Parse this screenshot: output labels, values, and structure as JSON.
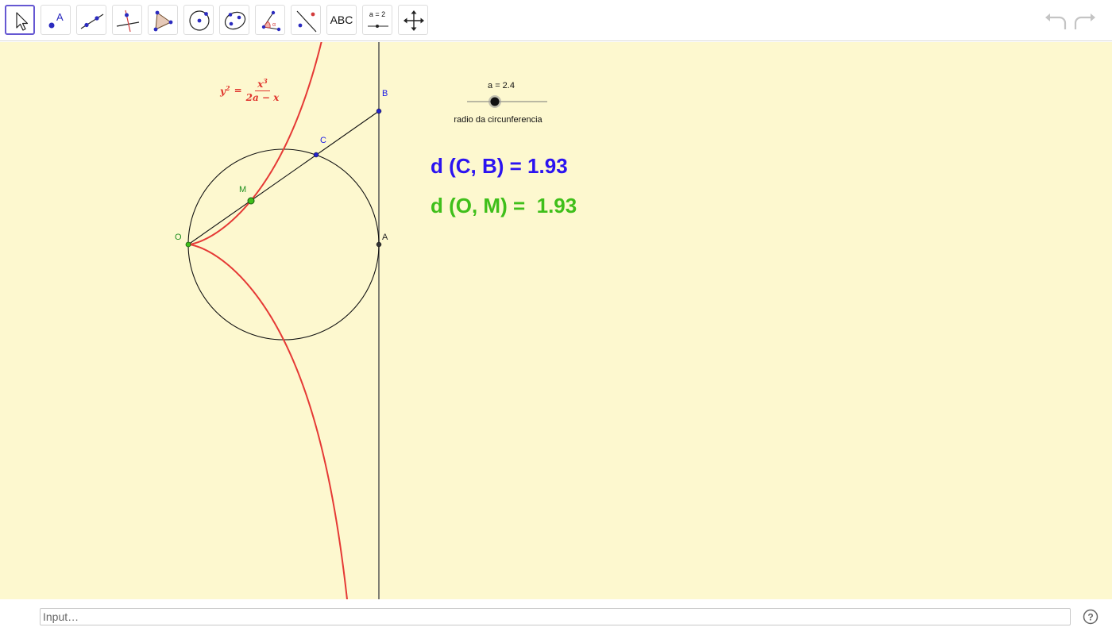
{
  "toolbar": {
    "tools": [
      {
        "id": "move",
        "icon": "arrow-pointer-icon"
      },
      {
        "id": "point",
        "icon": "point-icon",
        "text": "A"
      },
      {
        "id": "line",
        "icon": "line-through-points-icon"
      },
      {
        "id": "perpendicular",
        "icon": "perpendicular-line-icon"
      },
      {
        "id": "polygon",
        "icon": "polygon-icon"
      },
      {
        "id": "circle",
        "icon": "circle-center-point-icon"
      },
      {
        "id": "conic",
        "icon": "ellipse-icon"
      },
      {
        "id": "angle",
        "icon": "angle-icon"
      },
      {
        "id": "reflect",
        "icon": "reflect-about-line-icon"
      },
      {
        "id": "text",
        "icon": "text-tool-icon",
        "text": "ABC"
      },
      {
        "id": "slider",
        "icon": "slider-tool-icon",
        "text": "a = 2"
      },
      {
        "id": "move-view",
        "icon": "move-graphics-view-icon"
      }
    ],
    "undo_icon": "undo-icon",
    "redo_icon": "redo-icon"
  },
  "canvas": {
    "background": "#fdf8cf",
    "curve_color": "#e53935",
    "formula": {
      "lhs": "y",
      "lhs_exp": "2",
      "num": "x",
      "num_exp": "3",
      "den": "2a − x"
    },
    "points": {
      "O": "O",
      "M": "M",
      "C": "C",
      "B": "B",
      "A": "A"
    },
    "slider": {
      "caption": "a = 2.4",
      "description": "radio da circunferencia",
      "value": 2.4
    },
    "distance_cb": "d (C, B) = 1.93",
    "distance_om": "d (O, M) =  1.93",
    "colors": {
      "blue": "#2b13f0",
      "green": "#3fbf1a"
    }
  },
  "input_bar": {
    "placeholder": "Input…",
    "help_icon": "help-icon"
  }
}
